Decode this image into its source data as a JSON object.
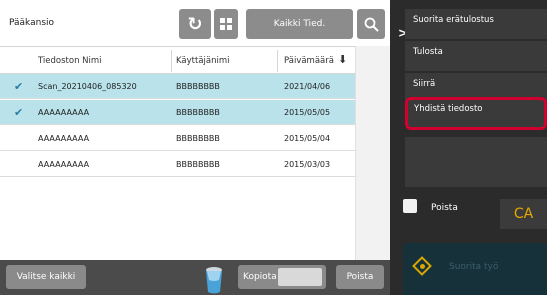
{
  "header": {
    "folder": "Pääkansio",
    "refresh_icon": "↻",
    "filter_label": "Kaikki Tied."
  },
  "table": {
    "columns": [
      "Tiedoston Nimi",
      "Käyttäjänimi",
      "Päivämäärä"
    ],
    "sort_icon": "⬇",
    "rows": [
      {
        "name": "Scan_20210406_085320",
        "user": "BBBBBBBB",
        "date": "2021/04/06",
        "selected": true
      },
      {
        "name": "AAAAAAAAA",
        "user": "BBBBBBBB",
        "date": "2015/05/05",
        "selected": true
      },
      {
        "name": "AAAAAAAAA",
        "user": "BBBBBBBB",
        "date": "2015/05/04",
        "selected": false
      },
      {
        "name": "AAAAAAAAA",
        "user": "BBBBBBBB",
        "date": "2015/03/03",
        "selected": false
      }
    ]
  },
  "bottom": {
    "select_all": "Valitse kaikki",
    "copy": "Kopiota",
    "delete": "Poista"
  },
  "side_menu": {
    "items": [
      "Suorita erätulostus",
      "Tulosta",
      "Siirrä",
      "Yhdistä tiedosto"
    ],
    "highlighted_index": 3,
    "delete_checkbox_label": "Poista",
    "ca_label": "CA",
    "start_label": "Suorita työ"
  },
  "colors": {
    "selected_row": "#b9e2ea",
    "highlight_border": "#d1002f",
    "ca_text": "#e8a800"
  }
}
